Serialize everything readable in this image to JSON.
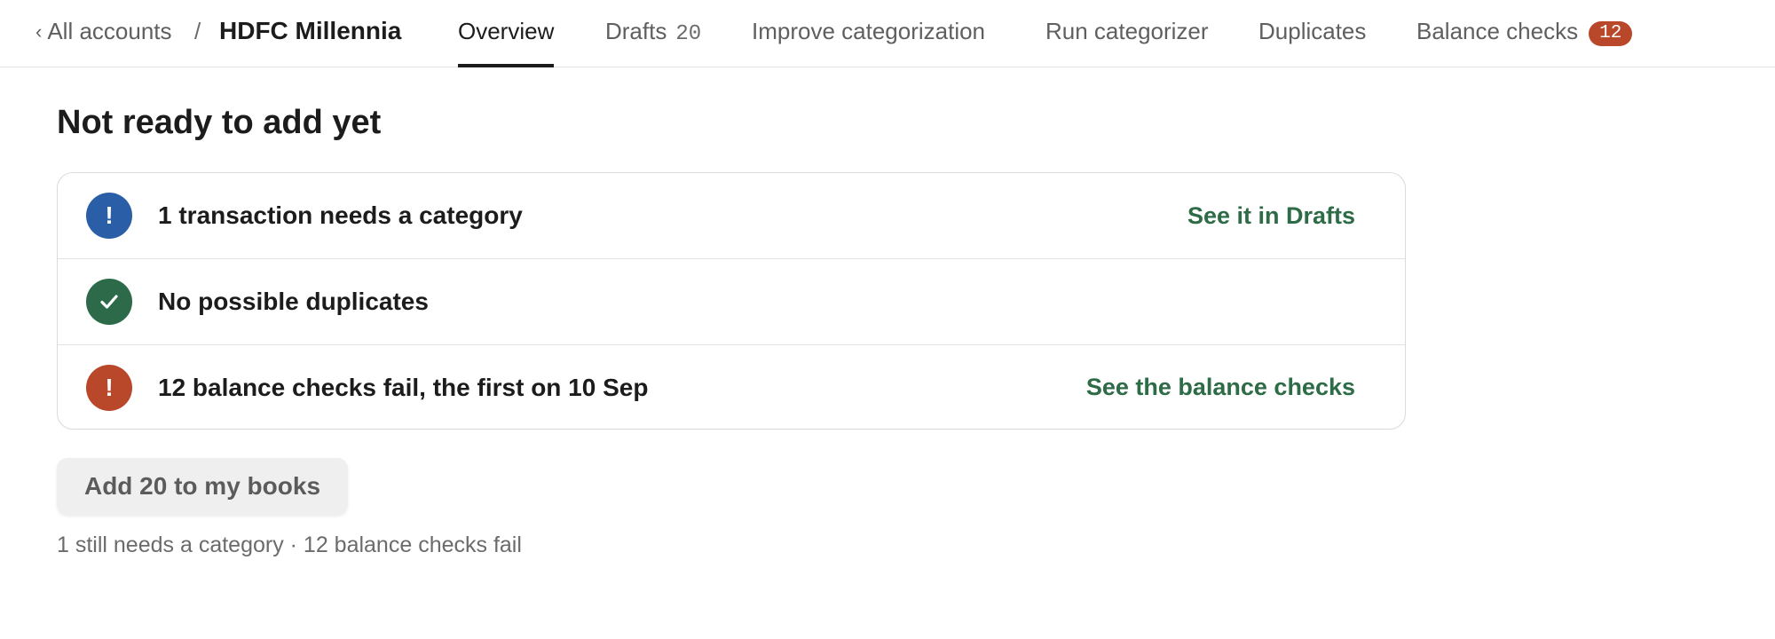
{
  "breadcrumb": {
    "back_label": "All accounts",
    "separator": "/",
    "current": "HDFC Millennia"
  },
  "tabs": [
    {
      "label": "Overview",
      "active": true
    },
    {
      "label": "Drafts",
      "count": "20"
    },
    {
      "label": "Improve categorization"
    },
    {
      "label": "Run categorizer"
    },
    {
      "label": "Duplicates"
    },
    {
      "label": "Balance checks",
      "badge": "12"
    }
  ],
  "main": {
    "heading": "Not ready to add yet",
    "checks": [
      {
        "status": "info",
        "icon": "exclamation-icon",
        "color": "#2a5fa8",
        "label": "1 transaction needs a category",
        "action": "See it in Drafts"
      },
      {
        "status": "ok",
        "icon": "check-icon",
        "color": "#2d6a4a",
        "label": "No possible duplicates",
        "action": ""
      },
      {
        "status": "error",
        "icon": "exclamation-icon",
        "color": "#b9472a",
        "label": "12 balance checks fail, the first on 10 Sep",
        "action": "See the balance checks"
      }
    ],
    "primary_button": "Add 20 to my books",
    "summary": "1 still needs a category · 12 balance checks fail"
  },
  "colors": {
    "accent_link": "#2e6b47",
    "badge": "#b9472a",
    "text": "#1c1c1c",
    "muted": "#5f5f5f"
  }
}
